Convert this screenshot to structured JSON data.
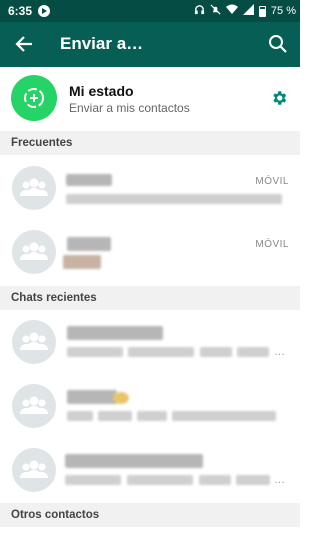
{
  "status_bar": {
    "time": "6:35",
    "battery": "75 %"
  },
  "app_bar": {
    "title": "Enviar a…"
  },
  "my_status": {
    "name": "Mi estado",
    "subtitle": "Enviar a mis contactos"
  },
  "sections": {
    "frequent": "Frecuentes",
    "recent": "Chats recientes",
    "others": "Otros contactos"
  },
  "frequent": [
    {
      "tag": "MÓVIL"
    },
    {
      "tag": "MÓVIL"
    }
  ],
  "recent_ellipsis": "…",
  "colors": {
    "status_bar": "#054d44",
    "app_bar": "#075e54",
    "accent_green": "#25d366",
    "settings_teal": "#00897b"
  },
  "icons": {
    "back": "arrow-left",
    "search": "magnifier",
    "settings": "gear",
    "status_add": "dashed-circle-plus",
    "group_avatar": "people-group"
  }
}
